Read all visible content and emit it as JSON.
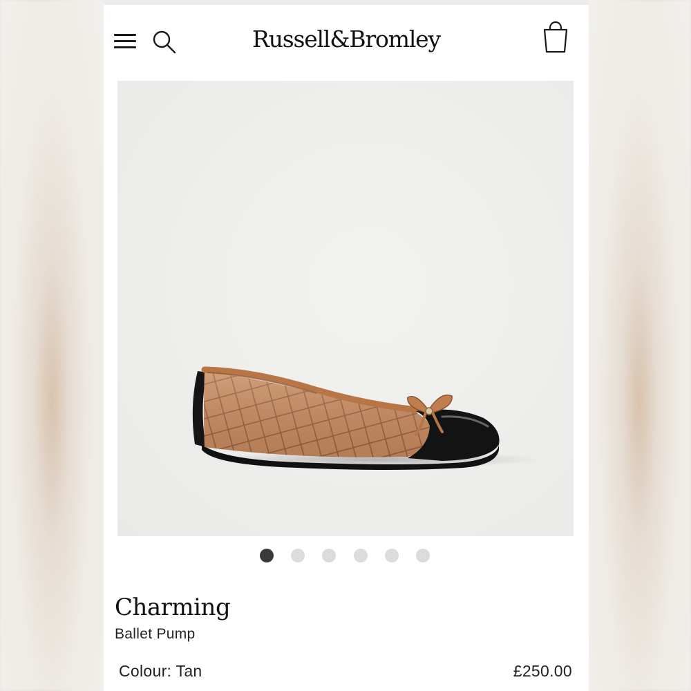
{
  "header": {
    "logo_text": "Russell&Bromley",
    "icons": [
      "menu-icon",
      "search-icon",
      "bag-icon"
    ]
  },
  "product": {
    "image_alt": "tan quilted ballet pump with black patent toe cap and bow",
    "carousel": {
      "total": 6,
      "active_index": 0
    },
    "name": "Charming",
    "type": "Ballet Pump",
    "colour": "Colour: Tan",
    "price": "£250.00"
  },
  "colors": {
    "accent": "#111111",
    "dot_active": "#3a3a3a",
    "dot_inactive": "#dcdcdc",
    "shoe_tan": "#c88a5c",
    "shoe_toe": "#141414"
  }
}
